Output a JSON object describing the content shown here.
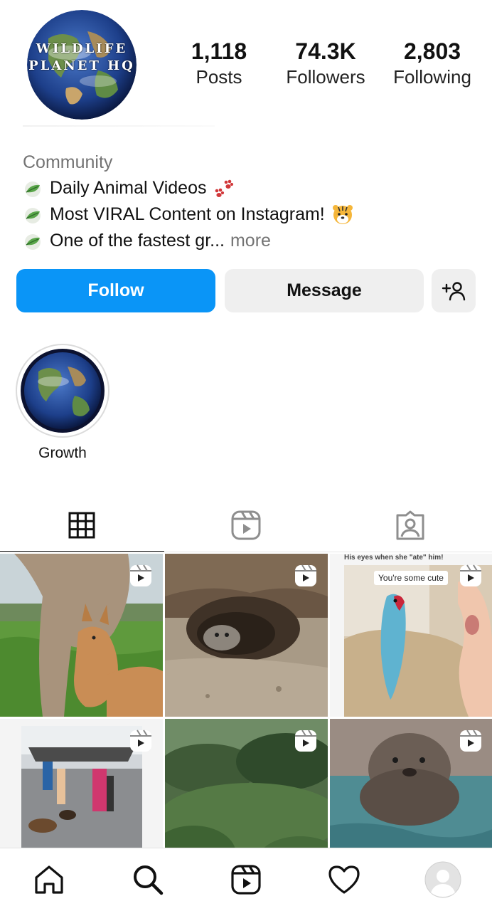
{
  "profile": {
    "avatar_text_line1": "WILDLIFE",
    "avatar_text_line2": "PLANET HQ",
    "avatar_icon": "globe-icon"
  },
  "stats": {
    "posts_count": "1,118",
    "posts_label": "Posts",
    "followers_count": "74.3K",
    "followers_label": "Followers",
    "following_count": "2,803",
    "following_label": "Following"
  },
  "bio": {
    "category": "Community",
    "line1": "Daily Animal Videos",
    "line1_emoji": "paw-prints-icon",
    "line2": "Most VIRAL Content on Instagram!",
    "line2_emoji": "tiger-face-icon",
    "line3": "One of the fastest gr...",
    "more": "more",
    "bullet_icon": "leaf-icon"
  },
  "actions": {
    "follow_label": "Follow",
    "message_label": "Message",
    "add_user_icon": "add-user-icon"
  },
  "highlights": [
    {
      "label": "Growth",
      "icon": "globe-icon"
    }
  ],
  "tabs": [
    {
      "icon": "grid-icon",
      "active": true
    },
    {
      "icon": "reels-icon",
      "active": false
    },
    {
      "icon": "tagged-icon",
      "active": false
    }
  ],
  "grid": {
    "tiles": [
      {
        "scene": "kangaroo-with-joey",
        "badge": "reels-icon"
      },
      {
        "scene": "kitten-in-burrow",
        "badge": "reels-icon"
      },
      {
        "scene": "parrot-on-sofa",
        "badge": "reels-icon",
        "chip": "You're some cute",
        "top_caption": "His eyes when she \"ate\" him!"
      },
      {
        "scene": "street-party-dogs",
        "badge": "reels-icon"
      },
      {
        "scene": "garden-bushes",
        "badge": "reels-icon"
      },
      {
        "scene": "otter-in-water",
        "badge": "reels-icon"
      }
    ]
  },
  "bottom_nav": [
    {
      "icon": "home-icon"
    },
    {
      "icon": "search-icon"
    },
    {
      "icon": "reels-icon"
    },
    {
      "icon": "heart-icon"
    },
    {
      "icon": "profile-avatar"
    }
  ],
  "colors": {
    "accent": "#0a95f7",
    "button_gray": "#efefef",
    "muted_text": "#737373"
  }
}
